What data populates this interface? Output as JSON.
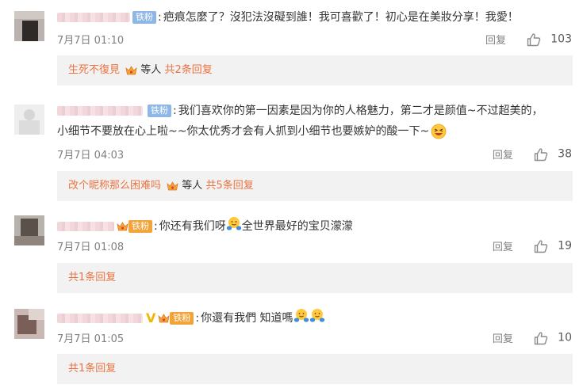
{
  "comments": [
    {
      "fan_badge": "铁粉",
      "text": "疤痕怎麼了？沒犯法沒礙到誰！我可喜歡了！初心是在美妝分享！我愛！",
      "time": "7月7日 01:10",
      "reply_label": "回复",
      "likes": "103",
      "reply_summary": {
        "user": "生死不復見",
        "middle": "等人",
        "count": "共2条回复"
      }
    },
    {
      "fan_badge": "铁粉",
      "text_line1": "我们喜欢你的第一因素是因为你的人格魅力，第二才是颜值~不过超美的，",
      "text_line2": "小细节不要放在心上啦~~你太优秀才会有人抓到小细节也要嫉妒的酸一下~",
      "time": "7月7日 04:03",
      "reply_label": "回复",
      "likes": "38",
      "reply_summary": {
        "user": "改个昵称那么困难吗",
        "middle": "等人",
        "count": "共5条回复"
      }
    },
    {
      "fan_badge": "铁粉",
      "text_a": "你还有我们呀",
      "text_b": "全世界最好的宝贝濛濛",
      "time": "7月7日 01:08",
      "reply_label": "回复",
      "likes": "19",
      "reply_summary": {
        "count": "共1条回复"
      }
    },
    {
      "fan_badge": "铁粉",
      "text": "你還有我們 知道嗎",
      "time": "7月7日 01:05",
      "reply_label": "回复",
      "likes": "10",
      "reply_summary": {
        "count": "共1条回复"
      }
    }
  ],
  "colors": {
    "link": "#eb7340",
    "meta": "#808080",
    "reply_bg": "#f2f2f2",
    "fan_badge": "#8eb7e6"
  },
  "icons": [
    "thumb-up-icon",
    "smiley-icon",
    "hug-emoji-icon",
    "crown-icon",
    "verified-v-icon"
  ]
}
